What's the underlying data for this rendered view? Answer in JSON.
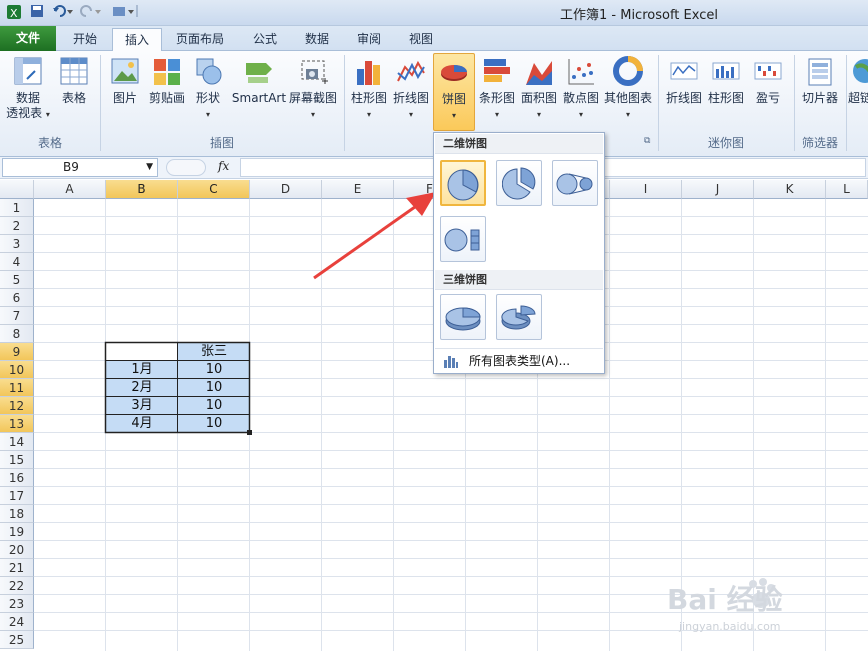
{
  "window": {
    "title": "工作簿1 - Microsoft Excel"
  },
  "quick_access": {
    "save_icon": "save-icon",
    "undo_icon": "undo-icon",
    "redo_icon": "redo-icon"
  },
  "tabs": [
    "文件",
    "开始",
    "插入",
    "页面布局",
    "公式",
    "数据",
    "审阅",
    "视图"
  ],
  "active_tab": "插入",
  "ribbon": {
    "groups": {
      "table": "表格",
      "illustrations": "插图",
      "charts": "图表",
      "sparklines": "迷你图",
      "filter": "筛选器"
    },
    "buttons": {
      "pivot_line1": "数据",
      "pivot_line2": "透视表",
      "table": "表格",
      "picture": "图片",
      "clipart": "剪贴画",
      "shapes": "形状",
      "smartart": "SmartArt",
      "screenshot": "屏幕截图",
      "column": "柱形图",
      "line": "折线图",
      "pie": "饼图",
      "bar": "条形图",
      "area": "面积图",
      "scatter": "散点图",
      "other": "其他图表",
      "spark_line": "折线图",
      "spark_column": "柱形图",
      "spark_winloss": "盈亏",
      "slicer": "切片器",
      "hyperlink_partial": "超链"
    }
  },
  "formula_bar": {
    "name_box": "B9",
    "fx": "fx",
    "value": ""
  },
  "columns": [
    "A",
    "B",
    "C",
    "D",
    "E",
    "F",
    "G",
    "H",
    "I",
    "J",
    "K",
    "L"
  ],
  "rows": [
    "1",
    "2",
    "3",
    "4",
    "5",
    "6",
    "7",
    "8",
    "9",
    "10",
    "11",
    "12",
    "13",
    "14",
    "15",
    "16",
    "17",
    "18",
    "19",
    "20",
    "21",
    "22",
    "23",
    "24",
    "25"
  ],
  "table": {
    "header": [
      "",
      "张三"
    ],
    "rows": [
      [
        "1月",
        "10"
      ],
      [
        "2月",
        "10"
      ],
      [
        "3月",
        "10"
      ],
      [
        "4月",
        "10"
      ]
    ]
  },
  "pie_menu": {
    "section_2d": "二维饼图",
    "section_3d": "三维饼图",
    "all_chart_types": "所有图表类型(A)..."
  },
  "watermark": {
    "brand": "Bai 经验",
    "url": "jingyan.baidu.com"
  },
  "colors": {
    "file_tab": "#1d6f22",
    "selection": "#c5dcf5",
    "header_highlight": "#f2c65a",
    "arrow": "#e8413c"
  }
}
